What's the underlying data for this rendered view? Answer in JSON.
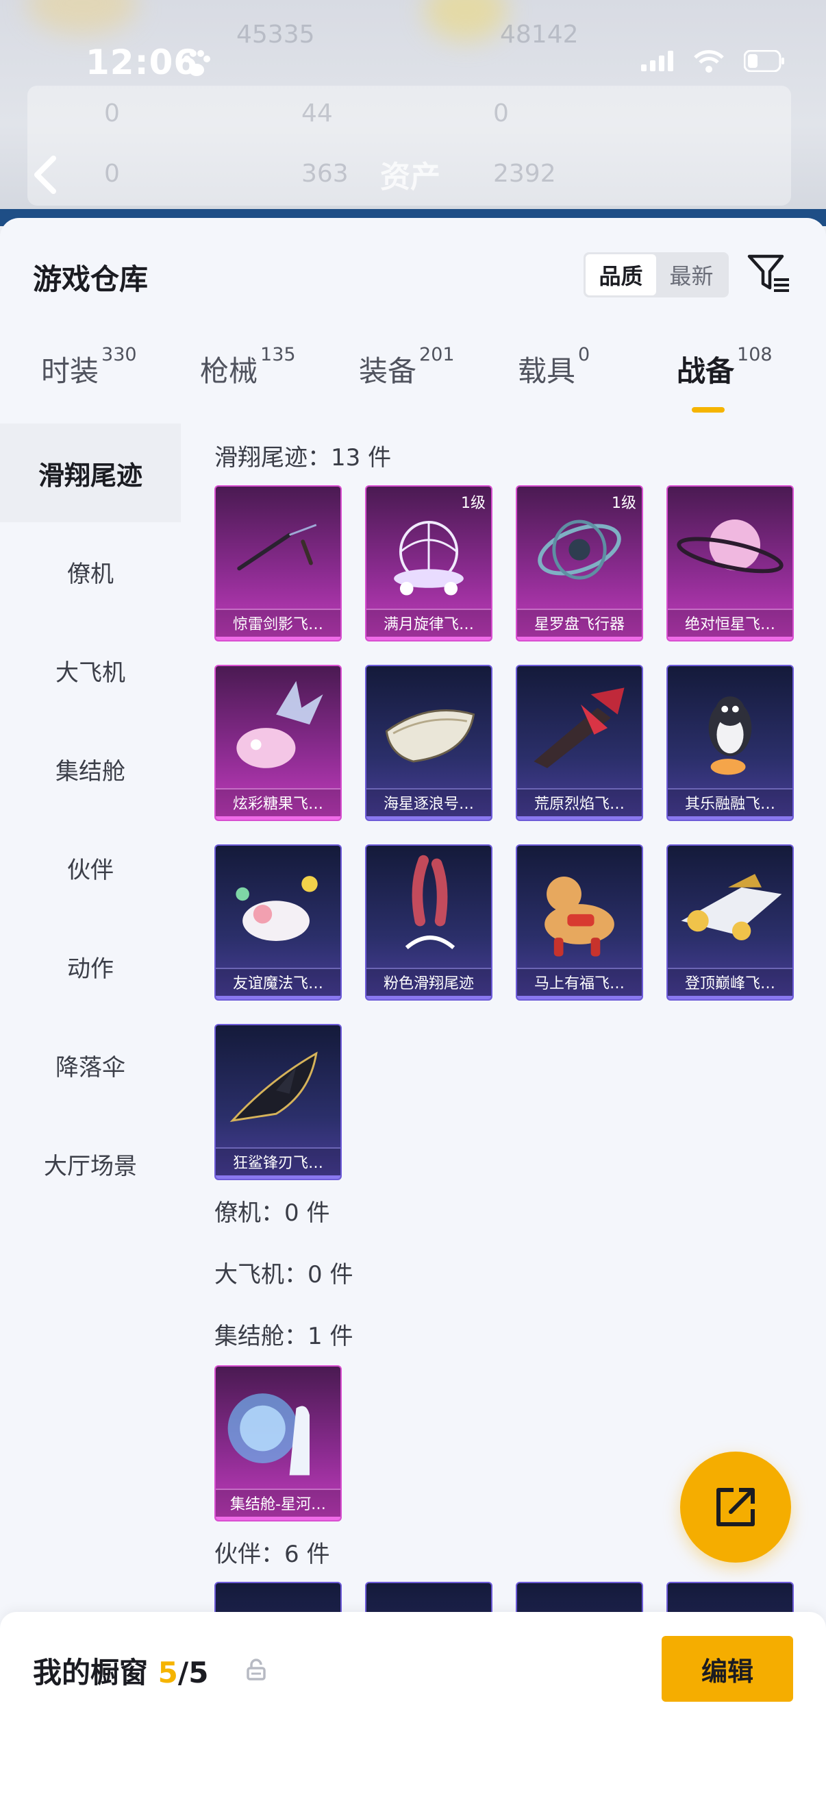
{
  "status_bar": {
    "time": "12:06"
  },
  "background": {
    "ghost_texts": [
      "45335",
      "48142",
      "44",
      "0",
      "0",
      "0",
      "0",
      "363",
      "2392",
      "0"
    ],
    "header_title": "资产"
  },
  "sheet": {
    "title": "游戏仓库",
    "sort": {
      "quality": "品质",
      "newest": "最新"
    }
  },
  "tabs": [
    {
      "label": "时装",
      "count": "330"
    },
    {
      "label": "枪械",
      "count": "135"
    },
    {
      "label": "装备",
      "count": "201"
    },
    {
      "label": "载具",
      "count": "0"
    },
    {
      "label": "战备",
      "count": "108"
    }
  ],
  "nav": [
    "滑翔尾迹",
    "僚机",
    "大飞机",
    "集结舱",
    "伙伴",
    "动作",
    "降落伞",
    "大厅场景"
  ],
  "sections": {
    "glider": {
      "label": "滑翔尾迹：13 件"
    },
    "wingman": {
      "label": "僚机：0 件"
    },
    "plane": {
      "label": "大飞机：0 件"
    },
    "pod": {
      "label": "集结舱：1 件"
    },
    "partner": {
      "label": "伙伴：6 件"
    }
  },
  "items": [
    {
      "name": "惊雷剑影飞…",
      "rarity": "purple",
      "badge": ""
    },
    {
      "name": "满月旋律飞…",
      "rarity": "purple",
      "badge": "1级"
    },
    {
      "name": "星罗盘飞行器",
      "rarity": "purple",
      "badge": "1级"
    },
    {
      "name": "绝对恒星飞…",
      "rarity": "purple",
      "badge": ""
    },
    {
      "name": "炫彩糖果飞…",
      "rarity": "purple",
      "badge": ""
    },
    {
      "name": "海星逐浪号…",
      "rarity": "blue",
      "badge": ""
    },
    {
      "name": "荒原烈焰飞…",
      "rarity": "blue",
      "badge": ""
    },
    {
      "name": "其乐融融飞…",
      "rarity": "blue",
      "badge": ""
    },
    {
      "name": "友谊魔法飞…",
      "rarity": "blue",
      "badge": ""
    },
    {
      "name": "粉色滑翔尾迹",
      "rarity": "blue",
      "badge": ""
    },
    {
      "name": "马上有福飞…",
      "rarity": "blue",
      "badge": ""
    },
    {
      "name": "登顶巅峰飞…",
      "rarity": "blue",
      "badge": ""
    },
    {
      "name": "狂鲨锋刃飞…",
      "rarity": "blue",
      "badge": ""
    },
    {
      "name": "集结舱-星河…",
      "rarity": "purple",
      "badge": ""
    }
  ],
  "bottom": {
    "label": "我的橱窗",
    "count_current": "5",
    "count_sep": "/",
    "count_total": "5",
    "edit": "编辑"
  },
  "colors": {
    "accent": "#f5ad00",
    "purple_rarity": "#c23cbd",
    "blue_rarity": "#6d5bd8"
  }
}
